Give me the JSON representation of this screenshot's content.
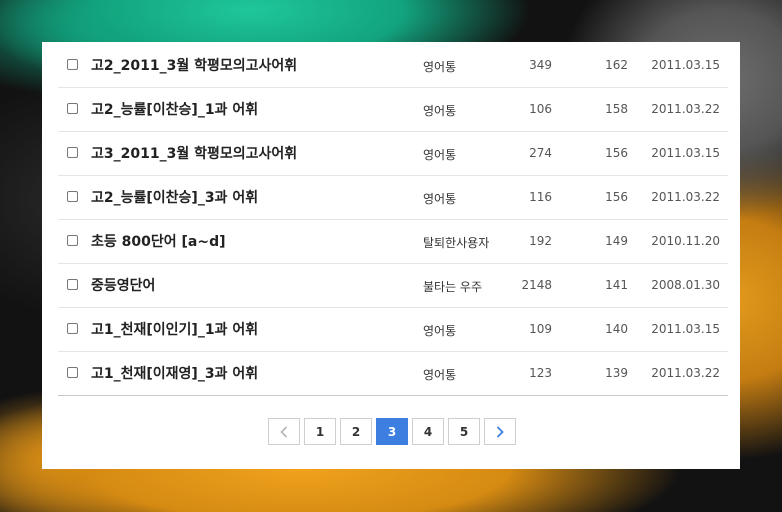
{
  "list": {
    "rows": [
      {
        "title": "고2_2011_3월 학평모의고사어휘",
        "author": "영어통",
        "count_a": "349",
        "count_b": "162",
        "date": "2011.03.15"
      },
      {
        "title": "고2_능률[이찬승]_1과 어휘",
        "author": "영어통",
        "count_a": "106",
        "count_b": "158",
        "date": "2011.03.22"
      },
      {
        "title": "고3_2011_3월 학평모의고사어휘",
        "author": "영어통",
        "count_a": "274",
        "count_b": "156",
        "date": "2011.03.15"
      },
      {
        "title": "고2_능률[이찬승]_3과 어휘",
        "author": "영어통",
        "count_a": "116",
        "count_b": "156",
        "date": "2011.03.22"
      },
      {
        "title": "초등 800단어 [a~d]",
        "author": "탈퇴한사용자",
        "count_a": "192",
        "count_b": "149",
        "date": "2010.11.20"
      },
      {
        "title": "중등영단어",
        "author": "불타는 우주",
        "count_a": "2148",
        "count_b": "141",
        "date": "2008.01.30"
      },
      {
        "title": "고1_천재[이인기]_1과 어휘",
        "author": "영어통",
        "count_a": "109",
        "count_b": "140",
        "date": "2011.03.15"
      },
      {
        "title": "고1_천재[이재영]_3과 어휘",
        "author": "영어통",
        "count_a": "123",
        "count_b": "139",
        "date": "2011.03.22"
      }
    ]
  },
  "pagination": {
    "pages": [
      "1",
      "2",
      "3",
      "4",
      "5"
    ],
    "current": "3",
    "prev_icon": "chevron-left-icon",
    "next_icon": "chevron-right-icon",
    "accent_color": "#3d7fe0"
  }
}
